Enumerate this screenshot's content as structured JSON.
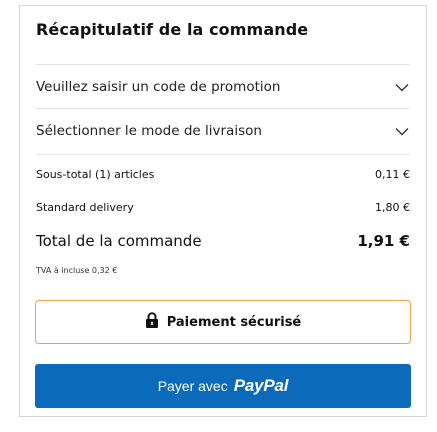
{
  "summary": {
    "title": "Récapitulatif de la commande",
    "promo_label": "Veuillez saisir un code de promotion",
    "delivery_label": "Sélectionner le mode de livraison",
    "subtotal_label": "Sous-total (1) articles",
    "subtotal_value": "0,11 €",
    "shipping_label": "Standard delivery",
    "shipping_value": "1,80 €",
    "total_label": "Total de la commande",
    "total_value": "1,91 €",
    "tax_note": "TVA à incluse 0,32 €"
  },
  "buttons": {
    "secure_label": "Paiement sécurisé",
    "paypal_prefix": "Payer avec",
    "paypal_brand": "PayPal"
  },
  "icons": {
    "chevron": "chevron-down-icon",
    "lock": "lock-icon"
  },
  "colors": {
    "paypal_blue": "#0b6bba",
    "secure_border": "#f0a04b"
  }
}
